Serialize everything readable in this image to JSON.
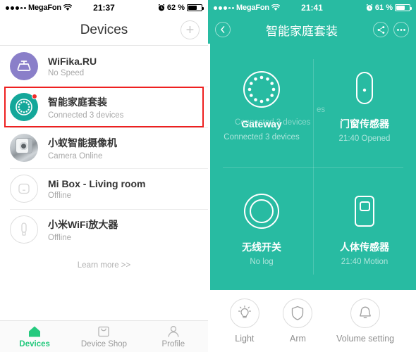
{
  "left": {
    "status_bar": {
      "signal_dots_filled": 3,
      "signal_dots_empty": 2,
      "carrier": "MegaFon",
      "wifi_icon": "wifi-icon",
      "time": "21:37",
      "alarm_icon": "alarm-clock-icon",
      "battery_percent": "62 %",
      "battery_level": 62
    },
    "nav": {
      "title": "Devices",
      "add_label": "+",
      "add_icon": "plus-icon"
    },
    "devices": [
      {
        "icon": "wifi-router-icon",
        "title": "WiFika.RU",
        "subtitle": "No Speed",
        "highlighted": false
      },
      {
        "icon": "gateway-icon",
        "title": "智能家庭套装",
        "subtitle": "Connected 3 devices",
        "highlighted": true
      },
      {
        "icon": "ip-camera-icon",
        "title": "小蚁智能摄像机",
        "subtitle": "Camera Online",
        "highlighted": false
      },
      {
        "icon": "set-top-box-icon",
        "title": "Mi Box - Living room",
        "subtitle": "Offline",
        "highlighted": false
      },
      {
        "icon": "wifi-extender-icon",
        "title": "小米WiFi放大器",
        "subtitle": "Offline",
        "highlighted": false
      }
    ],
    "learn_more": "Learn more >>",
    "tabs": [
      {
        "icon": "home-icon",
        "label": "Devices",
        "active": true
      },
      {
        "icon": "shopping-bag-icon",
        "label": "Device Shop",
        "active": false
      },
      {
        "icon": "person-icon",
        "label": "Profile",
        "active": false
      }
    ]
  },
  "right": {
    "status_bar": {
      "signal_dots_filled": 3,
      "signal_dots_empty": 2,
      "carrier": "MegaFon",
      "wifi_icon": "wifi-icon",
      "time": "21:41",
      "alarm_icon": "alarm-clock-icon",
      "battery_percent": "61 %",
      "battery_level": 61
    },
    "nav": {
      "back_icon": "chevron-left-icon",
      "title": "智能家庭套装",
      "share_icon": "share-icon",
      "more_icon": "more-ellipsis-icon"
    },
    "tiles": [
      {
        "icon": "gateway-ring-icon",
        "title": "Gateway",
        "subtitle": "Connected 3 devices"
      },
      {
        "icon": "door-window-sensor-icon",
        "title": "门窗传感器",
        "subtitle": "21:40 Opened"
      },
      {
        "icon": "wireless-switch-icon",
        "title": "无线开关",
        "subtitle": "No log"
      },
      {
        "icon": "motion-sensor-icon",
        "title": "人体传感器",
        "subtitle": "21:40 Motion"
      }
    ],
    "bleed_overlay": {
      "text_1": "Connected 3 devices",
      "text_2": "es"
    },
    "actions": [
      {
        "icon": "lightbulb-icon",
        "label": "Light"
      },
      {
        "icon": "shield-icon",
        "label": "Arm"
      },
      {
        "icon": "bell-icon",
        "label": "Volume setting"
      }
    ]
  },
  "colors": {
    "teal": "#28bba2",
    "gateway_teal": "#14a79a",
    "router_purple": "#8a7fc9",
    "highlight_red": "#ee2020",
    "tab_green": "#25c97e"
  }
}
